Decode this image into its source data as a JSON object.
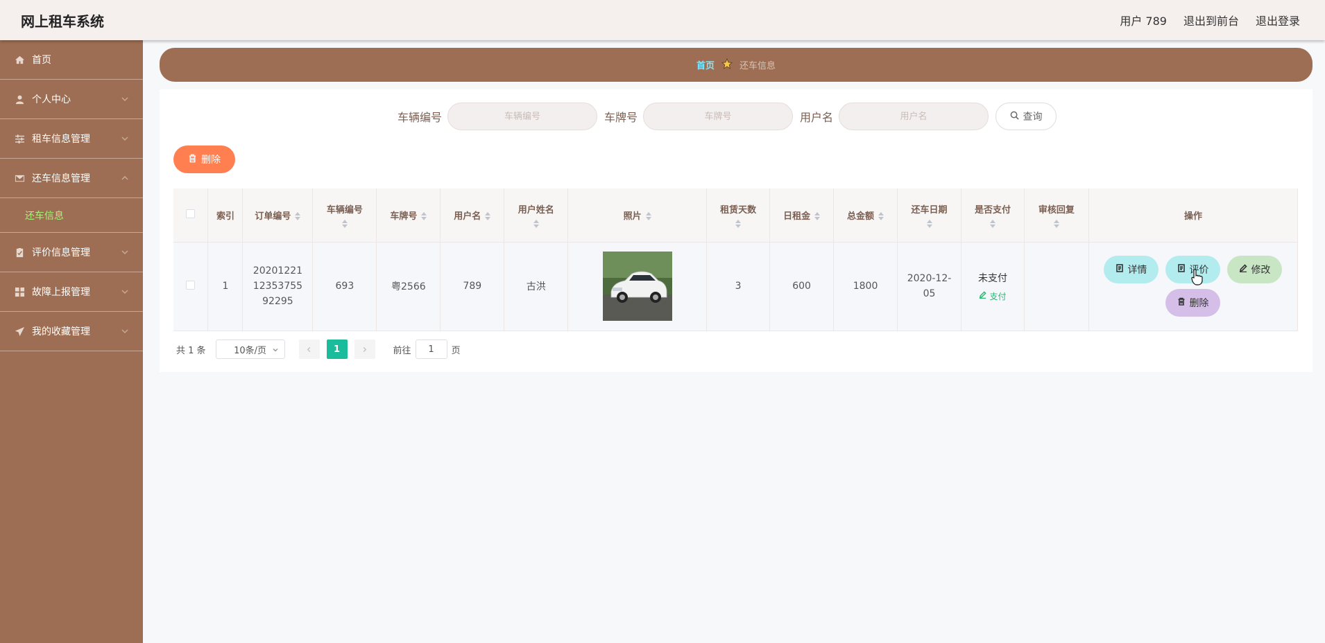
{
  "header": {
    "brand": "网上租车系统",
    "user": "用户 789",
    "front": "退出到前台",
    "logout": "退出登录"
  },
  "sidebar": {
    "items": [
      {
        "label": "首页"
      },
      {
        "label": "个人中心"
      },
      {
        "label": "租车信息管理"
      },
      {
        "label": "还车信息管理"
      },
      {
        "label": "还车信息"
      },
      {
        "label": "评价信息管理"
      },
      {
        "label": "故障上报管理"
      },
      {
        "label": "我的收藏管理"
      }
    ]
  },
  "breadcrumb": {
    "home": "首页",
    "current": "还车信息"
  },
  "search": {
    "fields": [
      {
        "label": "车辆编号",
        "placeholder": "车辆编号",
        "value": ""
      },
      {
        "label": "车牌号",
        "placeholder": "车牌号",
        "value": ""
      },
      {
        "label": "用户名",
        "placeholder": "用户名",
        "value": ""
      }
    ],
    "button": "查询"
  },
  "toolbar": {
    "delete": "删除"
  },
  "table": {
    "headers": [
      "索引",
      "订单编号",
      "车辆编号",
      "车牌号",
      "用户名",
      "用户姓名",
      "照片",
      "租赁天数",
      "日租金",
      "总金额",
      "还车日期",
      "是否支付",
      "审核回复",
      "操作"
    ],
    "rows": [
      {
        "index": "1",
        "order_no": "202012211235375592295",
        "vehicle_no": "693",
        "plate": "粤2566",
        "username": "789",
        "name": "古洪",
        "days": "3",
        "daily_rent": "600",
        "total": "1800",
        "return_date": "2020-12-05",
        "paid": "未支付",
        "pay_link": "支付",
        "review_reply": "",
        "actions": {
          "detail": "详情",
          "evaluate": "评价",
          "edit": "修改",
          "delete": "删除"
        }
      }
    ]
  },
  "pagination": {
    "total": "共 1 条",
    "page_size": "10条/页",
    "current_page": "1",
    "goto_prefix": "前往",
    "goto_value": "1",
    "goto_suffix": "页"
  },
  "colors": {
    "sidebar": "#9d6e53",
    "accent_orange": "#ff7f50",
    "page_active": "#1abc9c",
    "sub_active": "#a9f07a"
  }
}
